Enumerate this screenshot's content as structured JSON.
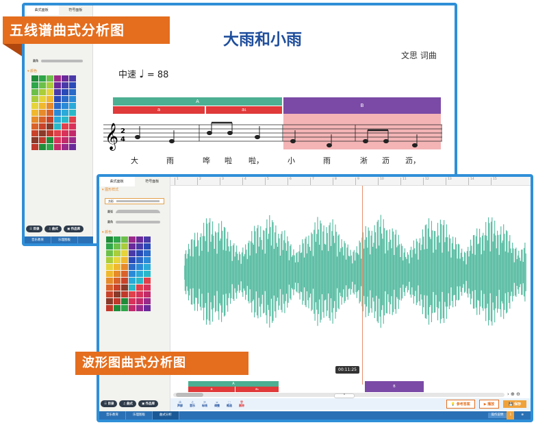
{
  "banner_top": "五线谱曲式分析图",
  "banner_bottom": "波形图曲式分析图",
  "score": {
    "title": "大雨和小雨",
    "author": "文思 词曲",
    "tempo_label": "中速",
    "tempo_value": "= 88",
    "time_sig_top": "2",
    "time_sig_bottom": "4",
    "sections": {
      "A": "A",
      "B": "B",
      "a": "a",
      "a1": "a₁"
    },
    "lyrics": [
      "大",
      "雨",
      "哗",
      "啦",
      "啦，",
      "小",
      "雨",
      "淅",
      "沥",
      "沥，"
    ]
  },
  "panel": {
    "tab1": "曲式面板",
    "tab2": "符号面板",
    "section_style": "图形样式",
    "section_color": "颜色",
    "line1": "方形",
    "line2": "圆弧",
    "line3": "圆角"
  },
  "nav": {
    "catalog": "目录",
    "form": "曲式",
    "works": "作品库"
  },
  "taskbar_top": [
    "音乐教育",
    "乐理图板"
  ],
  "taskbar_bottom": [
    "音乐教育",
    "乐理图板",
    "曲式分析"
  ],
  "wave": {
    "time": "00:11:25",
    "ruler": [
      "1",
      "2",
      "3",
      "4",
      "5",
      "6",
      "7",
      "8",
      "9",
      "10",
      "11",
      "12",
      "13",
      "14",
      "15"
    ],
    "sections": {
      "A": "A",
      "B": "B",
      "a": "a",
      "a1": "a₁"
    }
  },
  "toolbar": {
    "items": [
      "声部",
      "音乐",
      "标线",
      "调整",
      "框选",
      "删除"
    ],
    "ref": "参考答案",
    "play": "播放",
    "save": "保存"
  },
  "footer": {
    "label": "操作说明",
    "page": "1"
  },
  "colors": {
    "green": "#4caf92",
    "red": "#e03a3a",
    "purple": "#7b4aa6",
    "orange": "#e46e1e",
    "blue": "#2f8fd8",
    "wave": "#4db89c"
  }
}
